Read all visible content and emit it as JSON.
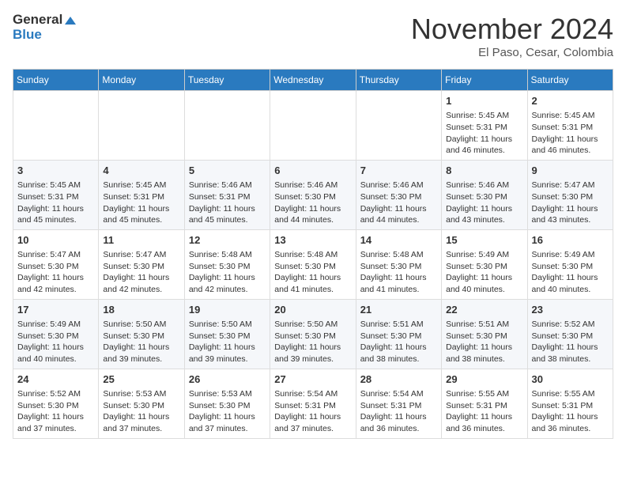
{
  "header": {
    "logo_line1": "General",
    "logo_line2": "Blue",
    "month": "November 2024",
    "location": "El Paso, Cesar, Colombia"
  },
  "weekdays": [
    "Sunday",
    "Monday",
    "Tuesday",
    "Wednesday",
    "Thursday",
    "Friday",
    "Saturday"
  ],
  "weeks": [
    [
      {
        "day": "",
        "info": ""
      },
      {
        "day": "",
        "info": ""
      },
      {
        "day": "",
        "info": ""
      },
      {
        "day": "",
        "info": ""
      },
      {
        "day": "",
        "info": ""
      },
      {
        "day": "1",
        "info": "Sunrise: 5:45 AM\nSunset: 5:31 PM\nDaylight: 11 hours and 46 minutes."
      },
      {
        "day": "2",
        "info": "Sunrise: 5:45 AM\nSunset: 5:31 PM\nDaylight: 11 hours and 46 minutes."
      }
    ],
    [
      {
        "day": "3",
        "info": "Sunrise: 5:45 AM\nSunset: 5:31 PM\nDaylight: 11 hours and 45 minutes."
      },
      {
        "day": "4",
        "info": "Sunrise: 5:45 AM\nSunset: 5:31 PM\nDaylight: 11 hours and 45 minutes."
      },
      {
        "day": "5",
        "info": "Sunrise: 5:46 AM\nSunset: 5:31 PM\nDaylight: 11 hours and 45 minutes."
      },
      {
        "day": "6",
        "info": "Sunrise: 5:46 AM\nSunset: 5:30 PM\nDaylight: 11 hours and 44 minutes."
      },
      {
        "day": "7",
        "info": "Sunrise: 5:46 AM\nSunset: 5:30 PM\nDaylight: 11 hours and 44 minutes."
      },
      {
        "day": "8",
        "info": "Sunrise: 5:46 AM\nSunset: 5:30 PM\nDaylight: 11 hours and 43 minutes."
      },
      {
        "day": "9",
        "info": "Sunrise: 5:47 AM\nSunset: 5:30 PM\nDaylight: 11 hours and 43 minutes."
      }
    ],
    [
      {
        "day": "10",
        "info": "Sunrise: 5:47 AM\nSunset: 5:30 PM\nDaylight: 11 hours and 42 minutes."
      },
      {
        "day": "11",
        "info": "Sunrise: 5:47 AM\nSunset: 5:30 PM\nDaylight: 11 hours and 42 minutes."
      },
      {
        "day": "12",
        "info": "Sunrise: 5:48 AM\nSunset: 5:30 PM\nDaylight: 11 hours and 42 minutes."
      },
      {
        "day": "13",
        "info": "Sunrise: 5:48 AM\nSunset: 5:30 PM\nDaylight: 11 hours and 41 minutes."
      },
      {
        "day": "14",
        "info": "Sunrise: 5:48 AM\nSunset: 5:30 PM\nDaylight: 11 hours and 41 minutes."
      },
      {
        "day": "15",
        "info": "Sunrise: 5:49 AM\nSunset: 5:30 PM\nDaylight: 11 hours and 40 minutes."
      },
      {
        "day": "16",
        "info": "Sunrise: 5:49 AM\nSunset: 5:30 PM\nDaylight: 11 hours and 40 minutes."
      }
    ],
    [
      {
        "day": "17",
        "info": "Sunrise: 5:49 AM\nSunset: 5:30 PM\nDaylight: 11 hours and 40 minutes."
      },
      {
        "day": "18",
        "info": "Sunrise: 5:50 AM\nSunset: 5:30 PM\nDaylight: 11 hours and 39 minutes."
      },
      {
        "day": "19",
        "info": "Sunrise: 5:50 AM\nSunset: 5:30 PM\nDaylight: 11 hours and 39 minutes."
      },
      {
        "day": "20",
        "info": "Sunrise: 5:50 AM\nSunset: 5:30 PM\nDaylight: 11 hours and 39 minutes."
      },
      {
        "day": "21",
        "info": "Sunrise: 5:51 AM\nSunset: 5:30 PM\nDaylight: 11 hours and 38 minutes."
      },
      {
        "day": "22",
        "info": "Sunrise: 5:51 AM\nSunset: 5:30 PM\nDaylight: 11 hours and 38 minutes."
      },
      {
        "day": "23",
        "info": "Sunrise: 5:52 AM\nSunset: 5:30 PM\nDaylight: 11 hours and 38 minutes."
      }
    ],
    [
      {
        "day": "24",
        "info": "Sunrise: 5:52 AM\nSunset: 5:30 PM\nDaylight: 11 hours and 37 minutes."
      },
      {
        "day": "25",
        "info": "Sunrise: 5:53 AM\nSunset: 5:30 PM\nDaylight: 11 hours and 37 minutes."
      },
      {
        "day": "26",
        "info": "Sunrise: 5:53 AM\nSunset: 5:30 PM\nDaylight: 11 hours and 37 minutes."
      },
      {
        "day": "27",
        "info": "Sunrise: 5:54 AM\nSunset: 5:31 PM\nDaylight: 11 hours and 37 minutes."
      },
      {
        "day": "28",
        "info": "Sunrise: 5:54 AM\nSunset: 5:31 PM\nDaylight: 11 hours and 36 minutes."
      },
      {
        "day": "29",
        "info": "Sunrise: 5:55 AM\nSunset: 5:31 PM\nDaylight: 11 hours and 36 minutes."
      },
      {
        "day": "30",
        "info": "Sunrise: 5:55 AM\nSunset: 5:31 PM\nDaylight: 11 hours and 36 minutes."
      }
    ]
  ]
}
